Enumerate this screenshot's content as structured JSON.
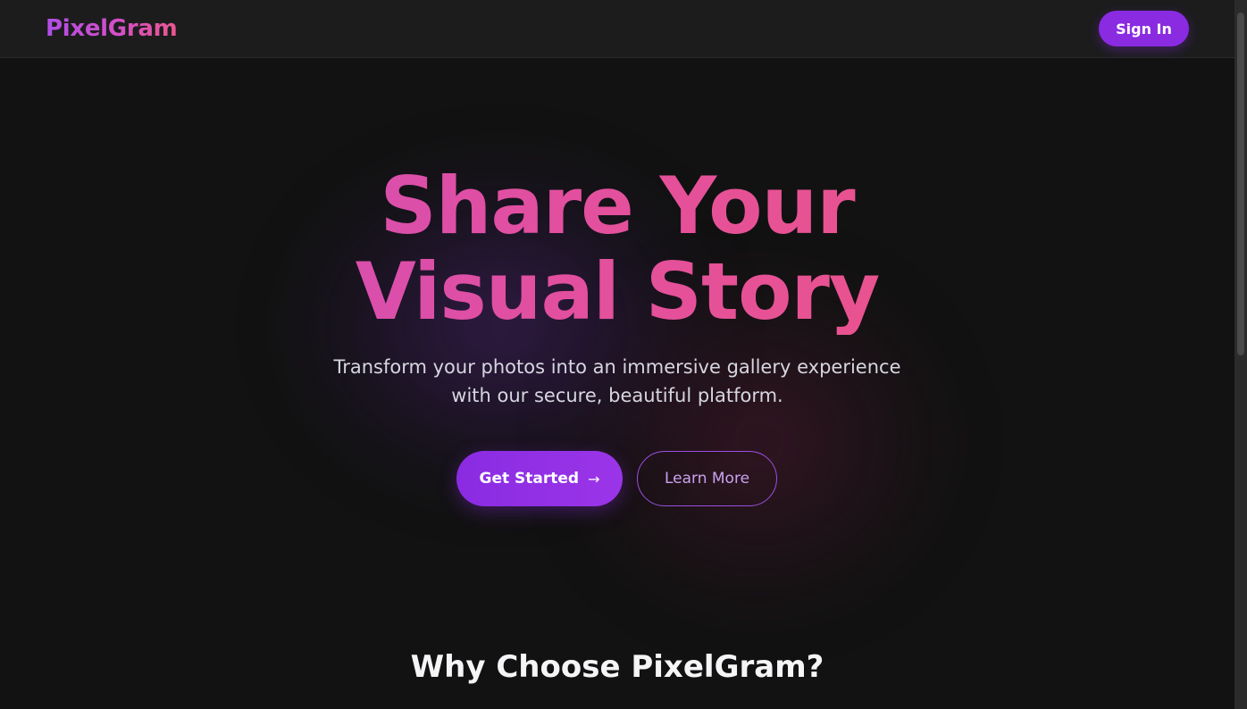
{
  "nav": {
    "logo": "PixelGram",
    "sign_in_label": "Sign In"
  },
  "hero": {
    "headline_line1": "Share Your",
    "headline_line2": "Visual Story",
    "subtitle_line1": "Transform your photos into an immersive gallery experience",
    "subtitle_line2": "with our secure, beautiful platform.",
    "primary_cta": "Get Started",
    "primary_cta_icon": "→",
    "secondary_cta": "Learn More"
  },
  "features": {
    "title": "Why Choose PixelGram?"
  },
  "colors": {
    "accent": "#8a2be2",
    "background": "#121212",
    "navbar": "#1c1c1d",
    "gradient_start": "#b04ee8",
    "gradient_end": "#f0577e"
  }
}
